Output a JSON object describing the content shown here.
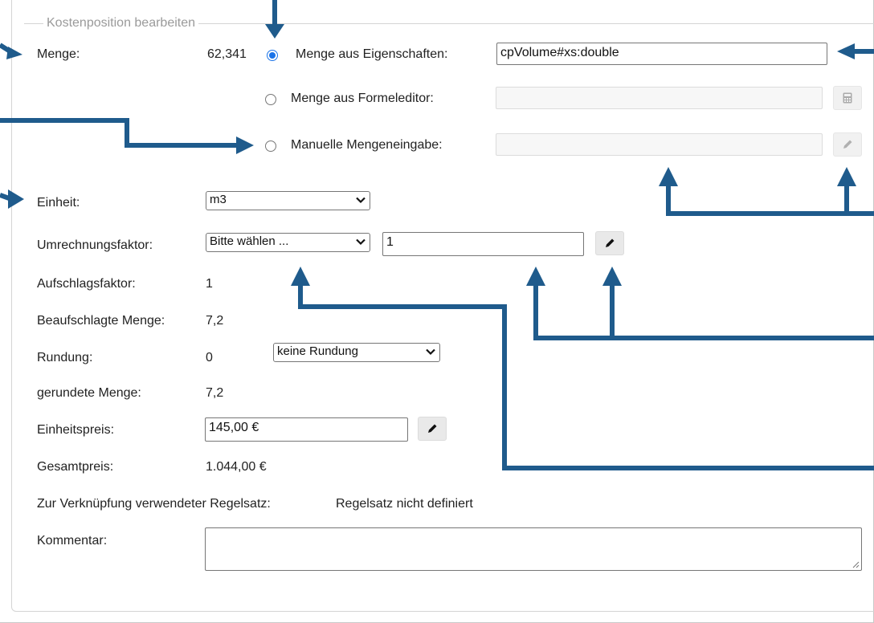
{
  "legend": "Kostenposition bearbeiten",
  "menge": {
    "label": "Menge:",
    "value": "62,341",
    "options": [
      {
        "label": "Menge aus Eigenschaften:",
        "value": "cpVolume#xs:double",
        "checked": true
      },
      {
        "label": "Menge aus Formeleditor:",
        "value": "",
        "checked": false
      },
      {
        "label": "Manuelle Mengeneingabe:",
        "value": "",
        "checked": false
      }
    ]
  },
  "einheit": {
    "label": "Einheit:",
    "selected": "m3"
  },
  "umrechnung": {
    "label": "Umrechnungsfaktor:",
    "selected": "Bitte wählen ...",
    "value": "1"
  },
  "aufschlag": {
    "label": "Aufschlagsfaktor:",
    "value": "1"
  },
  "beaufschlagt": {
    "label": "Beaufschlagte Menge:",
    "value": "7,2"
  },
  "rundung": {
    "label": "Rundung:",
    "value": "0",
    "selected": "keine Rundung"
  },
  "gerundet": {
    "label": "gerundete Menge:",
    "value": "7,2"
  },
  "einheitspreis": {
    "label": "Einheitspreis:",
    "value": "145,00 €"
  },
  "gesamtpreis": {
    "label": "Gesamtpreis:",
    "value": "1.044,00 €"
  },
  "regelsatz": {
    "label": "Zur Verknüpfung verwendeter Regelsatz:",
    "value": "Regelsatz nicht definiert"
  },
  "kommentar": {
    "label": "Kommentar:",
    "value": ""
  },
  "colors": {
    "arrow": "#1f5b8c",
    "radio": "#1a73e8",
    "legend": "#9a9a9a"
  },
  "icons": [
    "pencil-icon",
    "calculator-icon",
    "chevron-down-icon"
  ]
}
